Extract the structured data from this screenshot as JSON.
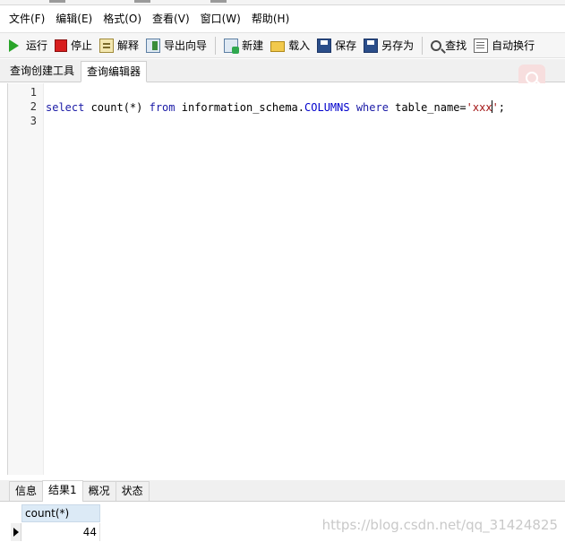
{
  "menubar": {
    "items": [
      "文件(F)",
      "编辑(E)",
      "格式(O)",
      "查看(V)",
      "窗口(W)",
      "帮助(H)"
    ]
  },
  "toolbar": {
    "run": "运行",
    "stop": "停止",
    "explain": "解释",
    "export_wizard": "导出向导",
    "new": "新建",
    "load": "载入",
    "save": "保存",
    "save_as": "另存为",
    "find": "查找",
    "word_wrap": "自动换行"
  },
  "subtabs": {
    "query_builder": "查询创建工具",
    "query_editor": "查询编辑器"
  },
  "editor": {
    "line_numbers": [
      "1",
      "2",
      "3"
    ],
    "code": {
      "kw_select": "select",
      "fn_count": " count(*) ",
      "kw_from": "from",
      "schema": " information_schema.",
      "table_id": "COLUMNS",
      "kw_where": "where",
      "col_cond": " table_name=",
      "string_literal": "'xxx",
      "string_close": "'",
      "terminator": ";"
    }
  },
  "result_tabs": [
    "信息",
    "结果1",
    "概况",
    "状态"
  ],
  "result": {
    "columns": [
      "count(*)"
    ],
    "rows": [
      [
        "44"
      ]
    ]
  },
  "watermark": "https://blog.csdn.net/qq_31424825"
}
